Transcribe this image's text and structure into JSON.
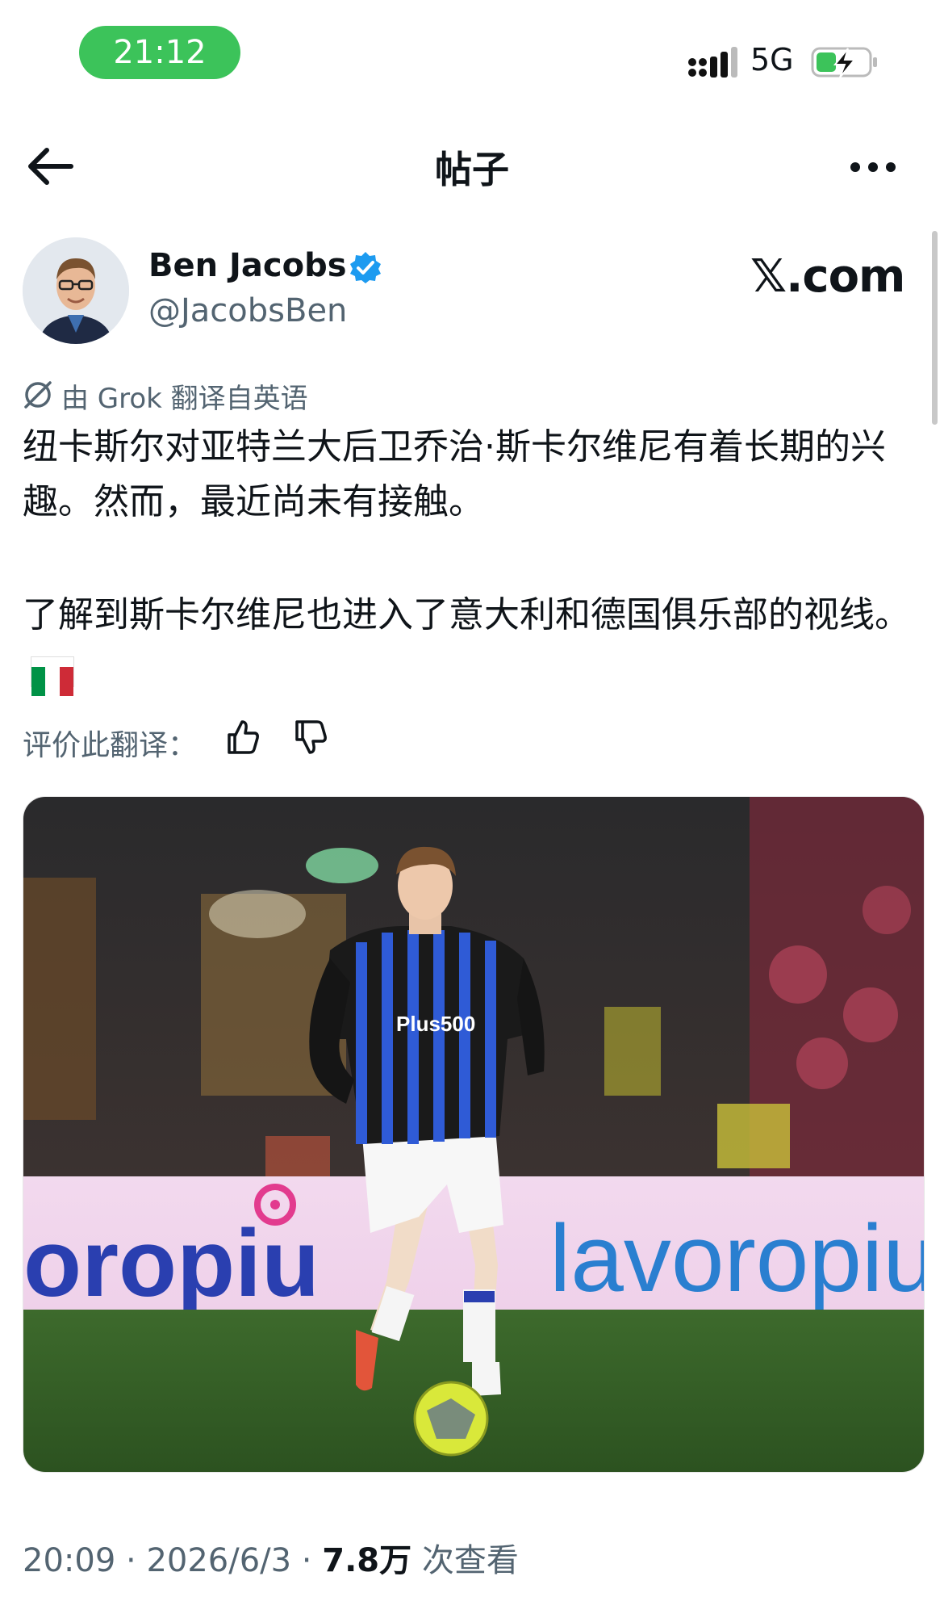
{
  "status_bar": {
    "time": "21:12",
    "network": "5G"
  },
  "nav": {
    "title": "帖子"
  },
  "author": {
    "name": "Ben Jacobs",
    "handle": "@JacobsBen",
    "watermark": "𝕏.com"
  },
  "translation": {
    "note": "由 Grok 翻译自英语"
  },
  "post": {
    "paragraph1": "纽卡斯尔对亚特兰大后卫乔治·斯卡尔维尼有着长期的兴趣。然而，最近尚未有接触。",
    "paragraph2": "了解到斯卡尔维尼也进入了意大利和德国俱乐部的视线。"
  },
  "rate": {
    "label": "评价此翻译："
  },
  "media": {
    "board_text_left": "oropiu",
    "board_text_right": "lavoropiu",
    "sponsor": "Plus500"
  },
  "footer": {
    "time": "20:09",
    "separator1": " · ",
    "date": "2026/6/3",
    "separator2": " · ",
    "views_count": "7.8万",
    "views_label": " 次查看"
  }
}
